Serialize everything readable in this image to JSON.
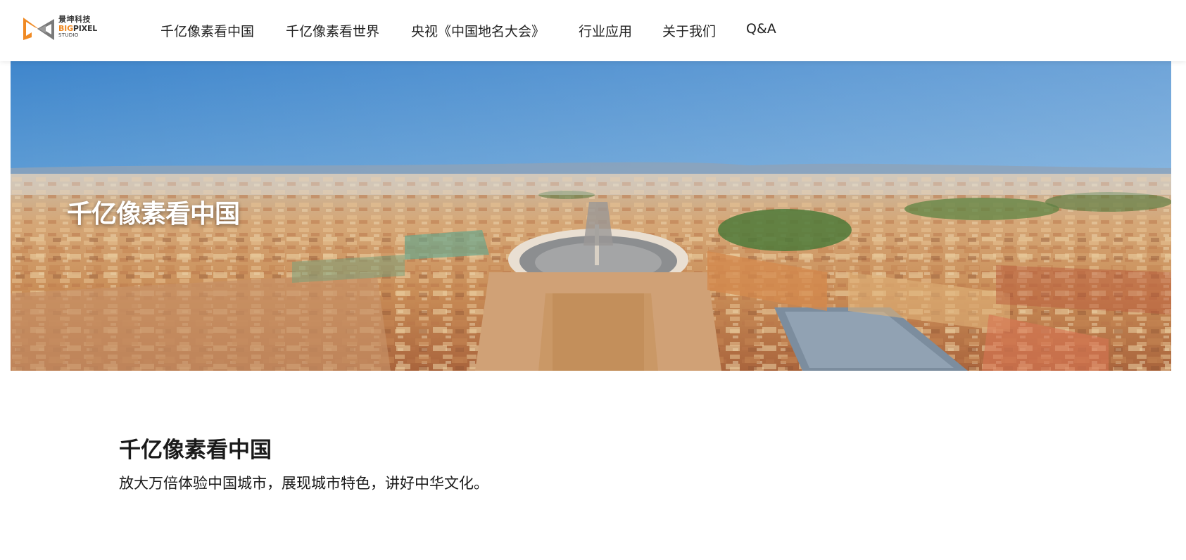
{
  "logo": {
    "name_cn": "景坤科技",
    "name_en_part1": "BIG",
    "name_en_part2": "PIXEL",
    "name_en_sub": "STUDIO"
  },
  "nav": {
    "items": [
      {
        "label": "千亿像素看中国"
      },
      {
        "label": "千亿像素看世界"
      },
      {
        "label": "央视《中国地名大会》"
      },
      {
        "label": "行业应用"
      },
      {
        "label": "关于我们"
      },
      {
        "label": "Q&A"
      }
    ]
  },
  "banner": {
    "title": "千亿像素看中国"
  },
  "section": {
    "title": "千亿像素看中国",
    "description": "放大万倍体验中国城市，展现城市特色，讲好中华文化。"
  },
  "colors": {
    "brand_orange": "#f08a24",
    "brand_gray": "#7a7a7a",
    "text": "#222222"
  }
}
